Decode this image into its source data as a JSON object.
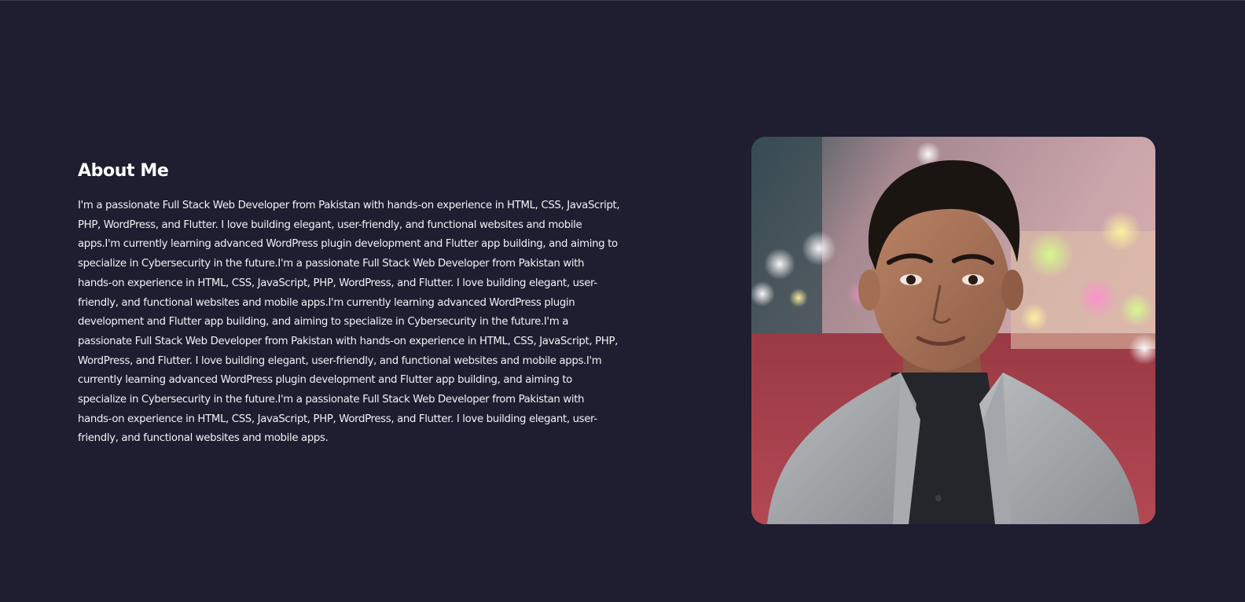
{
  "about": {
    "title": "About Me",
    "paragraph": "I'm a passionate Full Stack Web Developer from Pakistan with hands-on experience in HTML, CSS, JavaScript, PHP, WordPress, and Flutter. I love building elegant, user-friendly, and functional websites and mobile apps.I'm currently learning advanced WordPress plugin development and Flutter app building, and aiming to specialize in Cybersecurity in the future.I'm a passionate Full Stack Web Developer from Pakistan with hands-on experience in HTML, CSS, JavaScript, PHP, WordPress, and Flutter. I love building elegant, user-friendly, and functional websites and mobile apps.I'm currently learning advanced WordPress plugin development and Flutter app building, and aiming to specialize in Cybersecurity in the future.I'm a passionate Full Stack Web Developer from Pakistan with hands-on experience in HTML, CSS, JavaScript, PHP, WordPress, and Flutter. I love building elegant, user-friendly, and functional websites and mobile apps.I'm currently learning advanced WordPress plugin development and Flutter app building, and aiming to specialize in Cybersecurity in the future.I'm a passionate Full Stack Web Developer from Pakistan with hands-on experience in HTML, CSS, JavaScript, PHP, WordPress, and Flutter. I love building elegant, user-friendly, and functional websites and mobile apps."
  },
  "colors": {
    "background": "#1f1e30",
    "heading": "#ffffff",
    "body_text": "#f1f1f4"
  }
}
